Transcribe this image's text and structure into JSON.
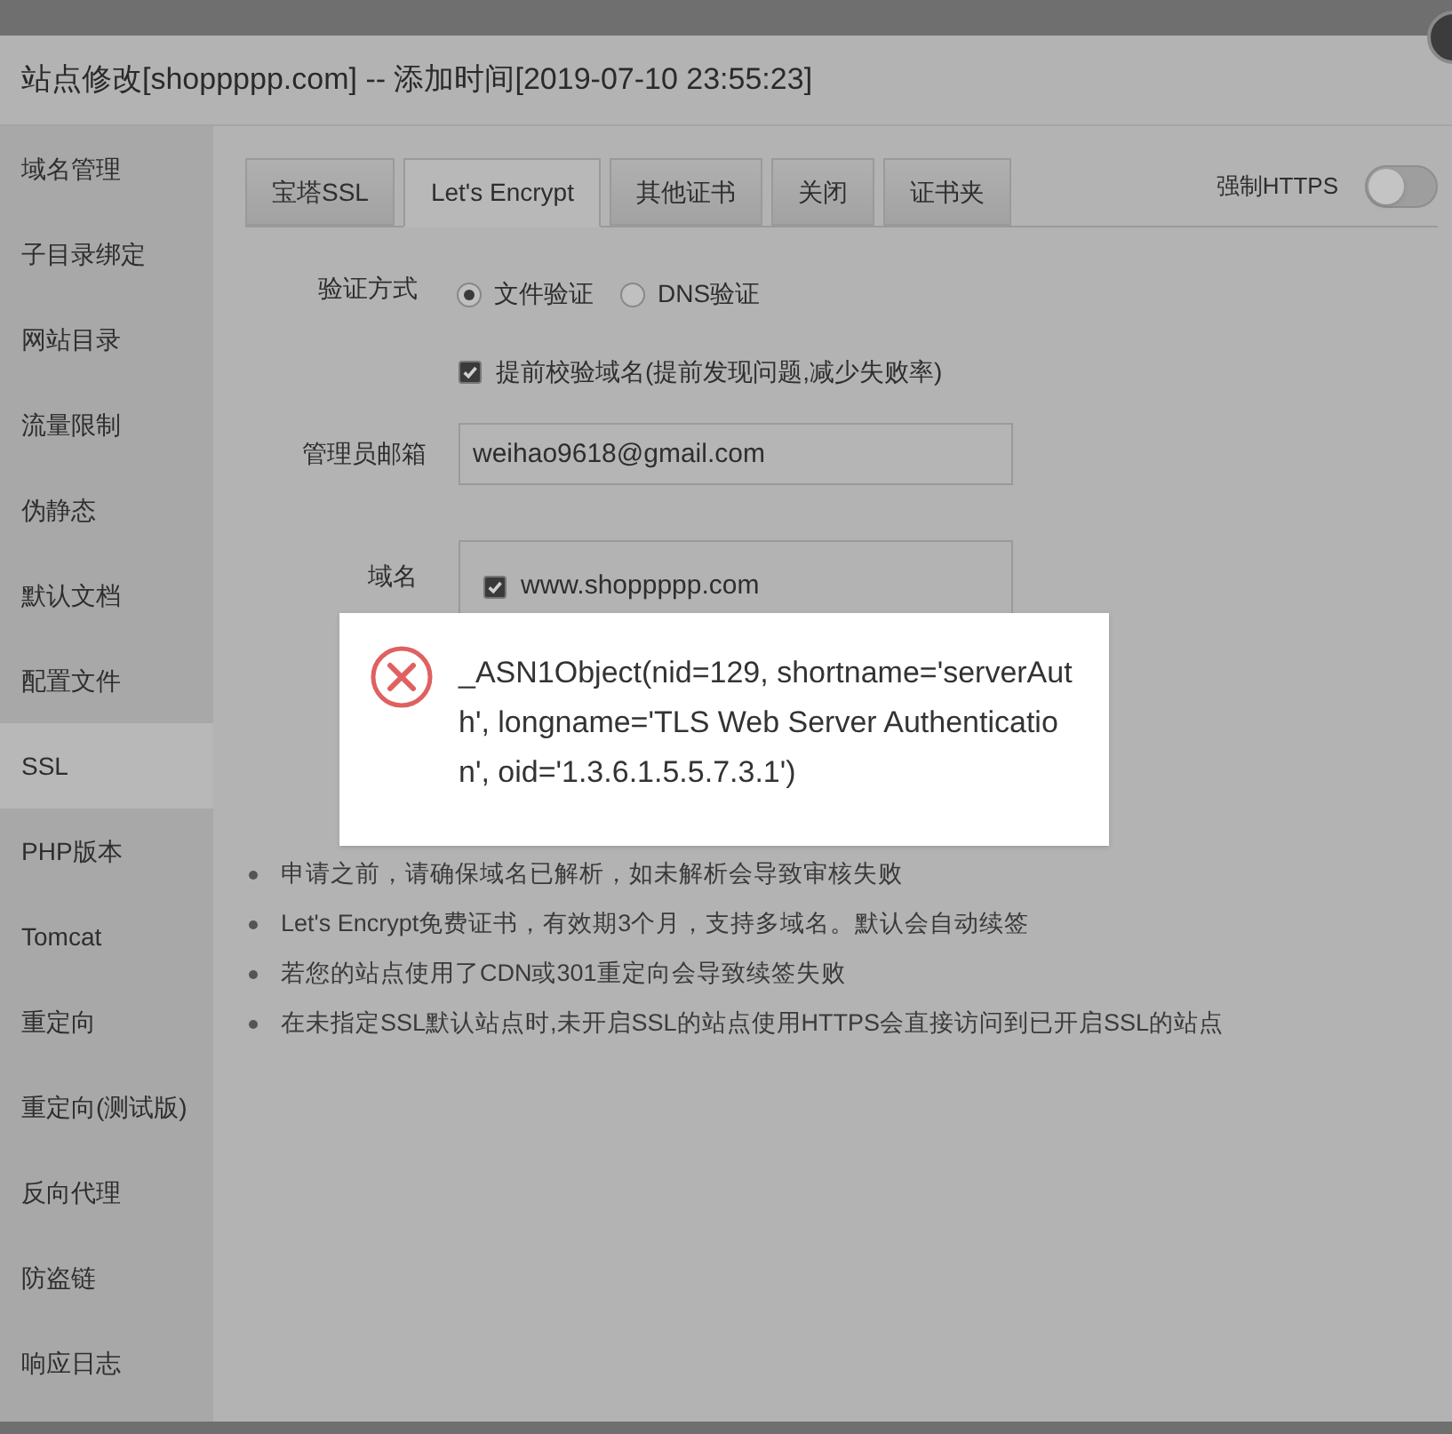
{
  "dialog": {
    "title": "站点修改[shoppppp.com] -- 添加时间[2019-07-10 23:55:23]"
  },
  "sidebar": {
    "items": [
      {
        "label": "域名管理",
        "selected": false
      },
      {
        "label": "子目录绑定",
        "selected": false
      },
      {
        "label": "网站目录",
        "selected": false
      },
      {
        "label": "流量限制",
        "selected": false
      },
      {
        "label": "伪静态",
        "selected": false
      },
      {
        "label": "默认文档",
        "selected": false
      },
      {
        "label": "配置文件",
        "selected": false
      },
      {
        "label": "SSL",
        "selected": true
      },
      {
        "label": "PHP版本",
        "selected": false
      },
      {
        "label": "Tomcat",
        "selected": false
      },
      {
        "label": "重定向",
        "selected": false
      },
      {
        "label": "重定向(测试版)",
        "selected": false
      },
      {
        "label": "反向代理",
        "selected": false
      },
      {
        "label": "防盗链",
        "selected": false
      },
      {
        "label": "响应日志",
        "selected": false
      }
    ]
  },
  "tabs": [
    {
      "label": "宝塔SSL",
      "selected": false
    },
    {
      "label": "Let's Encrypt",
      "selected": true
    },
    {
      "label": "其他证书",
      "selected": false
    },
    {
      "label": "关闭",
      "selected": false
    },
    {
      "label": "证书夹",
      "selected": false
    }
  ],
  "force_https": {
    "label": "强制HTTPS",
    "on": false
  },
  "form": {
    "verify_method": {
      "label": "验证方式",
      "options": [
        {
          "label": "文件验证",
          "selected": true
        },
        {
          "label": "DNS验证",
          "selected": false
        }
      ]
    },
    "precheck": {
      "label": "提前校验域名(提前发现问题,减少失败率)",
      "checked": true
    },
    "email": {
      "label": "管理员邮箱",
      "value": "weihao9618@gmail.com"
    },
    "domains": {
      "label": "域名",
      "items": [
        {
          "label": "www.shoppppp.com",
          "checked": true
        }
      ]
    }
  },
  "notes": [
    "申请之前，请确保域名已解析，如未解析会导致审核失败",
    "Let's Encrypt免费证书，有效期3个月，支持多域名。默认会自动续签",
    "若您的站点使用了CDN或301重定向会导致续签失败",
    "在未指定SSL默认站点时,未开启SSL的站点使用HTTPS会直接访问到已开启SSL的站点"
  ],
  "error_popup": {
    "message": "_ASN1Object(nid=129, shortname='serverAuth', longname='TLS Web Server Authentication', oid='1.3.6.1.5.5.7.3.1')"
  }
}
